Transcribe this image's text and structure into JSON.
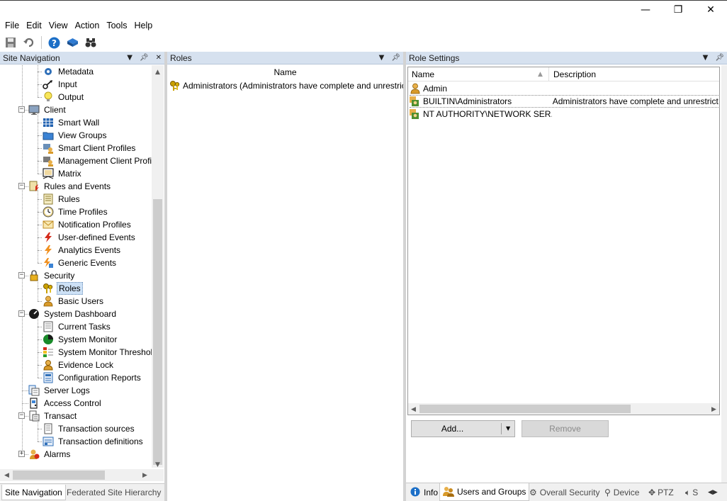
{
  "window": {
    "minimize_glyph": "—",
    "restore_glyph": "❐",
    "close_glyph": "✕"
  },
  "menu": [
    "File",
    "Edit",
    "View",
    "Action",
    "Tools",
    "Help"
  ],
  "toolbar_icons": [
    "save-icon",
    "undo-icon",
    "help-icon",
    "cube-icon",
    "binoculars-icon"
  ],
  "site_nav": {
    "title": "Site Navigation",
    "items": [
      {
        "label": "Metadata",
        "icon": "metadata-icon",
        "level": 2
      },
      {
        "label": "Input",
        "icon": "input-icon",
        "level": 2
      },
      {
        "label": "Output",
        "icon": "lightbulb-icon",
        "level": 2
      },
      {
        "label": "Client",
        "icon": "monitor-icon",
        "level": 1,
        "expander": "−"
      },
      {
        "label": "Smart Wall",
        "icon": "grid-icon",
        "level": 2
      },
      {
        "label": "View Groups",
        "icon": "folder-icon",
        "level": 2
      },
      {
        "label": "Smart Client Profiles",
        "icon": "client-profile-icon",
        "level": 2
      },
      {
        "label": "Management Client Profil",
        "icon": "management-profile-icon",
        "level": 2
      },
      {
        "label": "Matrix",
        "icon": "matrix-icon",
        "level": 2
      },
      {
        "label": "Rules and Events",
        "icon": "rules-events-icon",
        "level": 1,
        "expander": "−"
      },
      {
        "label": "Rules",
        "icon": "rules-icon",
        "level": 2
      },
      {
        "label": "Time Profiles",
        "icon": "clock-icon",
        "level": 2
      },
      {
        "label": "Notification Profiles",
        "icon": "envelope-icon",
        "level": 2
      },
      {
        "label": "User-defined Events",
        "icon": "lightning-icon",
        "level": 2
      },
      {
        "label": "Analytics Events",
        "icon": "analytics-lightning-icon",
        "level": 2
      },
      {
        "label": "Generic Events",
        "icon": "generic-event-icon",
        "level": 2
      },
      {
        "label": "Security",
        "icon": "lock-icon",
        "level": 1,
        "expander": "−"
      },
      {
        "label": "Roles",
        "icon": "keys-icon",
        "level": 2,
        "selected": true
      },
      {
        "label": "Basic Users",
        "icon": "user-icon",
        "level": 2
      },
      {
        "label": "System Dashboard",
        "icon": "dashboard-icon",
        "level": 1,
        "expander": "−"
      },
      {
        "label": "Current Tasks",
        "icon": "tasks-icon",
        "level": 2
      },
      {
        "label": "System Monitor",
        "icon": "monitor-gauge-icon",
        "level": 2
      },
      {
        "label": "System Monitor Threshol",
        "icon": "threshold-icon",
        "level": 2
      },
      {
        "label": "Evidence Lock",
        "icon": "evidence-lock-icon",
        "level": 2
      },
      {
        "label": "Configuration Reports",
        "icon": "report-icon",
        "level": 2
      },
      {
        "label": "Server Logs",
        "icon": "server-logs-icon",
        "level": 1
      },
      {
        "label": "Access Control",
        "icon": "access-control-icon",
        "level": 1
      },
      {
        "label": "Transact",
        "icon": "transact-icon",
        "level": 1,
        "expander": "−"
      },
      {
        "label": "Transaction sources",
        "icon": "transaction-source-icon",
        "level": 2
      },
      {
        "label": "Transaction definitions",
        "icon": "transaction-definition-icon",
        "level": 2
      },
      {
        "label": "Alarms",
        "icon": "alarm-bell-icon",
        "level": 1,
        "expander": "+"
      }
    ],
    "tabs": [
      "Site Navigation",
      "Federated Site Hierarchy"
    ]
  },
  "roles": {
    "title": "Roles",
    "column": "Name",
    "rows": [
      "Administrators (Administrators have complete and unrestrict"
    ]
  },
  "role_settings": {
    "title": "Role Settings",
    "columns": [
      "Name",
      "Description"
    ],
    "rows": [
      {
        "name": "Admin",
        "description": "",
        "icon": "user-icon"
      },
      {
        "name": "BUILTIN\\Administrators",
        "description": "Administrators have complete and unrestricted a",
        "icon": "group-icon"
      },
      {
        "name": "NT AUTHORITY\\NETWORK SER...",
        "description": "",
        "icon": "group-icon"
      }
    ],
    "add_button": "Add...",
    "remove_button": "Remove",
    "tabs": [
      "Info",
      "Users and Groups",
      "Overall Security",
      "Device",
      "PTZ",
      "S"
    ]
  }
}
